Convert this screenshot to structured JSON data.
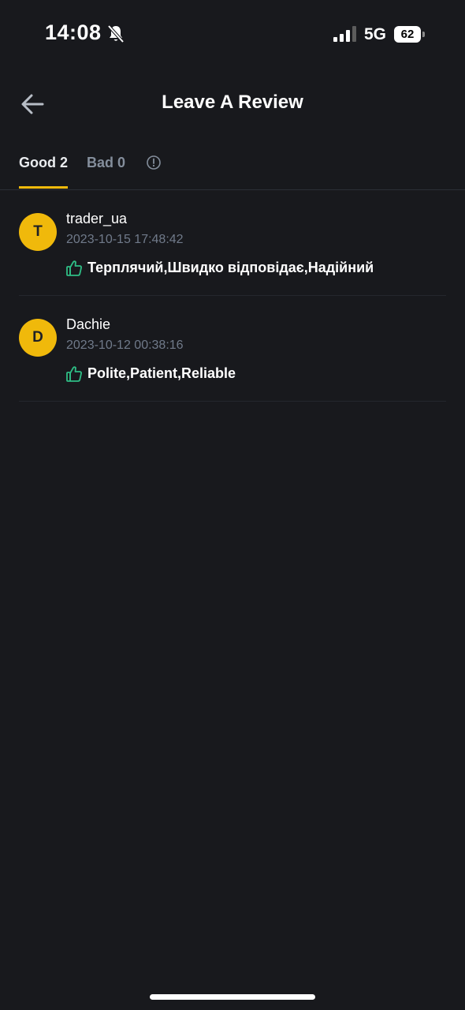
{
  "status_bar": {
    "time": "14:08",
    "network": "5G",
    "battery": "62"
  },
  "header": {
    "title": "Leave A Review"
  },
  "tabs": [
    {
      "label": "Good 2"
    },
    {
      "label": "Bad 0"
    }
  ],
  "colors": {
    "accent": "#f0b90b",
    "positive": "#2ebd85",
    "background": "#18191d"
  },
  "reviews": [
    {
      "avatar_letter": "T",
      "name": "trader_ua",
      "date": "2023-10-15 17:48:42",
      "tags": "Терплячий,Швидко відповідає,Надійний"
    },
    {
      "avatar_letter": "D",
      "name": "Dachie",
      "date": "2023-10-12 00:38:16",
      "tags": "Polite,Patient,Reliable"
    }
  ]
}
